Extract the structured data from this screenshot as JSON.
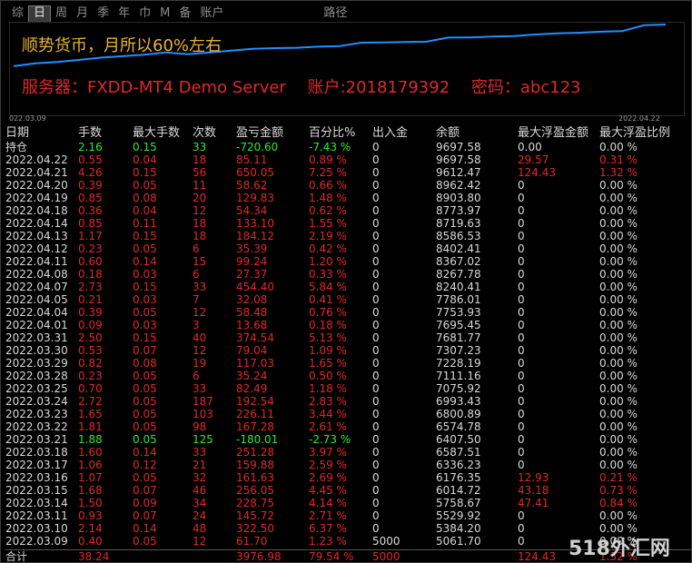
{
  "tabs": [
    "综",
    "日",
    "周",
    "月",
    "季",
    "年",
    "巾",
    "M",
    "备",
    "账户",
    "路径"
  ],
  "active_tab_index": 1,
  "overlay": {
    "line1": "顺势货币，月所以60%左右",
    "server": "服务器：FXDD-MT4 Demo Server",
    "account": "账户:2018179392",
    "password": "密码：abc123"
  },
  "chart": {
    "date_start": "022.03.09",
    "date_end": "2022.04.22",
    "line_color": "#1e90ff",
    "balance_series": [
      5061.7,
      5384.2,
      5529.92,
      5758.67,
      6014.72,
      6176.35,
      6336.23,
      6587.51,
      6407.5,
      6574.78,
      6800.89,
      6993.43,
      7075.92,
      7111.16,
      7228.19,
      7307.23,
      7681.77,
      7695.45,
      7753.93,
      7786.01,
      8240.41,
      8267.78,
      8367.02,
      8402.41,
      8586.53,
      8719.63,
      8773.97,
      8903.8,
      8962.42,
      9612.47,
      9697.58
    ]
  },
  "table": {
    "headers": [
      "日期",
      "手数",
      "最大手数",
      "次数",
      "盈亏金额",
      "百分比%",
      "出入金",
      "余额",
      "最大浮盈金额",
      "最大浮盈比例"
    ],
    "open_row": {
      "date": "持仓",
      "lots": "2.16",
      "max_lots": "0.15",
      "count": "33",
      "pnl": "-720.60",
      "pct": "-7.43 %",
      "inout": "0",
      "balance": "9697.58",
      "max_float": "0.00",
      "max_float_pct": "0.00 %"
    },
    "rows": [
      {
        "date": "2022.04.22",
        "lots": "0.55",
        "max_lots": "0.04",
        "count": "18",
        "pnl": "85.11",
        "pct": "0.89 %",
        "inout": "0",
        "balance": "9697.58",
        "max_float": "29.57",
        "max_float_pct": "0.31 %"
      },
      {
        "date": "2022.04.21",
        "lots": "4.26",
        "max_lots": "0.15",
        "count": "56",
        "pnl": "650.05",
        "pct": "7.25 %",
        "inout": "0",
        "balance": "9612.47",
        "max_float": "124.43",
        "max_float_pct": "1.32 %"
      },
      {
        "date": "2022.04.20",
        "lots": "0.39",
        "max_lots": "0.05",
        "count": "11",
        "pnl": "58.62",
        "pct": "0.66 %",
        "inout": "0",
        "balance": "8962.42",
        "max_float": "0",
        "max_float_pct": "0.00 %"
      },
      {
        "date": "2022.04.19",
        "lots": "0.85",
        "max_lots": "0.08",
        "count": "20",
        "pnl": "129.83",
        "pct": "1.48 %",
        "inout": "0",
        "balance": "8903.80",
        "max_float": "0",
        "max_float_pct": "0.00 %"
      },
      {
        "date": "2022.04.18",
        "lots": "0.36",
        "max_lots": "0.04",
        "count": "12",
        "pnl": "54.34",
        "pct": "0.62 %",
        "inout": "0",
        "balance": "8773.97",
        "max_float": "0",
        "max_float_pct": "0.00 %"
      },
      {
        "date": "2022.04.14",
        "lots": "0.85",
        "max_lots": "0.11",
        "count": "18",
        "pnl": "133.10",
        "pct": "1.55 %",
        "inout": "0",
        "balance": "8719.63",
        "max_float": "0",
        "max_float_pct": "0.00 %"
      },
      {
        "date": "2022.04.13",
        "lots": "1.17",
        "max_lots": "0.15",
        "count": "18",
        "pnl": "184.12",
        "pct": "2.19 %",
        "inout": "0",
        "balance": "8586.53",
        "max_float": "0",
        "max_float_pct": "0.00 %"
      },
      {
        "date": "2022.04.12",
        "lots": "0.23",
        "max_lots": "0.05",
        "count": "6",
        "pnl": "35.39",
        "pct": "0.42 %",
        "inout": "0",
        "balance": "8402.41",
        "max_float": "0",
        "max_float_pct": "0.00 %"
      },
      {
        "date": "2022.04.11",
        "lots": "0.60",
        "max_lots": "0.14",
        "count": "15",
        "pnl": "99.24",
        "pct": "1.20 %",
        "inout": "0",
        "balance": "8367.02",
        "max_float": "0",
        "max_float_pct": "0.00 %"
      },
      {
        "date": "2022.04.08",
        "lots": "0.18",
        "max_lots": "0.03",
        "count": "6",
        "pnl": "27.37",
        "pct": "0.33 %",
        "inout": "0",
        "balance": "8267.78",
        "max_float": "0",
        "max_float_pct": "0.00 %"
      },
      {
        "date": "2022.04.07",
        "lots": "2.73",
        "max_lots": "0.15",
        "count": "33",
        "pnl": "454.40",
        "pct": "5.84 %",
        "inout": "0",
        "balance": "8240.41",
        "max_float": "0",
        "max_float_pct": "0.00 %"
      },
      {
        "date": "2022.04.05",
        "lots": "0.21",
        "max_lots": "0.03",
        "count": "7",
        "pnl": "32.08",
        "pct": "0.41 %",
        "inout": "0",
        "balance": "7786.01",
        "max_float": "0",
        "max_float_pct": "0.00 %"
      },
      {
        "date": "2022.04.04",
        "lots": "0.39",
        "max_lots": "0.05",
        "count": "12",
        "pnl": "58.48",
        "pct": "0.76 %",
        "inout": "0",
        "balance": "7753.93",
        "max_float": "0",
        "max_float_pct": "0.00 %"
      },
      {
        "date": "2022.04.01",
        "lots": "0.09",
        "max_lots": "0.03",
        "count": "3",
        "pnl": "13.68",
        "pct": "0.18 %",
        "inout": "0",
        "balance": "7695.45",
        "max_float": "0",
        "max_float_pct": "0.00 %"
      },
      {
        "date": "2022.03.31",
        "lots": "2.50",
        "max_lots": "0.15",
        "count": "40",
        "pnl": "374.54",
        "pct": "5.13 %",
        "inout": "0",
        "balance": "7681.77",
        "max_float": "0",
        "max_float_pct": "0.00 %"
      },
      {
        "date": "2022.03.30",
        "lots": "0.53",
        "max_lots": "0.07",
        "count": "12",
        "pnl": "79.04",
        "pct": "1.09 %",
        "inout": "0",
        "balance": "7307.23",
        "max_float": "0",
        "max_float_pct": "0.00 %"
      },
      {
        "date": "2022.03.29",
        "lots": "0.82",
        "max_lots": "0.08",
        "count": "19",
        "pnl": "117.03",
        "pct": "1.65 %",
        "inout": "0",
        "balance": "7228.19",
        "max_float": "0",
        "max_float_pct": "0.00 %"
      },
      {
        "date": "2022.03.28",
        "lots": "0.23",
        "max_lots": "0.05",
        "count": "6",
        "pnl": "35.24",
        "pct": "0.50 %",
        "inout": "0",
        "balance": "7111.16",
        "max_float": "0",
        "max_float_pct": "0.00 %"
      },
      {
        "date": "2022.03.25",
        "lots": "0.70",
        "max_lots": "0.05",
        "count": "33",
        "pnl": "82.49",
        "pct": "1.18 %",
        "inout": "0",
        "balance": "7075.92",
        "max_float": "0",
        "max_float_pct": "0.00 %"
      },
      {
        "date": "2022.03.24",
        "lots": "2.72",
        "max_lots": "0.05",
        "count": "187",
        "pnl": "192.54",
        "pct": "2.83 %",
        "inout": "0",
        "balance": "6993.43",
        "max_float": "0",
        "max_float_pct": "0.00 %"
      },
      {
        "date": "2022.03.23",
        "lots": "1.65",
        "max_lots": "0.05",
        "count": "103",
        "pnl": "226.11",
        "pct": "3.44 %",
        "inout": "0",
        "balance": "6800.89",
        "max_float": "0",
        "max_float_pct": "0.00 %"
      },
      {
        "date": "2022.03.22",
        "lots": "1.81",
        "max_lots": "0.05",
        "count": "98",
        "pnl": "167.28",
        "pct": "2.61 %",
        "inout": "0",
        "balance": "6574.78",
        "max_float": "0",
        "max_float_pct": "0.00 %"
      },
      {
        "date": "2022.03.21",
        "lots": "1.88",
        "max_lots": "0.05",
        "count": "125",
        "pnl": "-180.01",
        "pct": "-2.73 %",
        "inout": "0",
        "balance": "6407.50",
        "max_float": "0",
        "max_float_pct": "0.00 %"
      },
      {
        "date": "2022.03.18",
        "lots": "1.60",
        "max_lots": "0.14",
        "count": "33",
        "pnl": "251.28",
        "pct": "3.97 %",
        "inout": "0",
        "balance": "6587.51",
        "max_float": "0",
        "max_float_pct": "0.00 %"
      },
      {
        "date": "2022.03.17",
        "lots": "1.06",
        "max_lots": "0.12",
        "count": "21",
        "pnl": "159.88",
        "pct": "2.59 %",
        "inout": "0",
        "balance": "6336.23",
        "max_float": "0",
        "max_float_pct": "0.00 %"
      },
      {
        "date": "2022.03.16",
        "lots": "1.07",
        "max_lots": "0.05",
        "count": "32",
        "pnl": "161.63",
        "pct": "2.69 %",
        "inout": "0",
        "balance": "6176.35",
        "max_float": "12.93",
        "max_float_pct": "0.21 %"
      },
      {
        "date": "2022.03.15",
        "lots": "1.68",
        "max_lots": "0.07",
        "count": "46",
        "pnl": "256.05",
        "pct": "4.45 %",
        "inout": "0",
        "balance": "6014.72",
        "max_float": "43.18",
        "max_float_pct": "0.73 %"
      },
      {
        "date": "2022.03.14",
        "lots": "1.50",
        "max_lots": "0.09",
        "count": "34",
        "pnl": "228.75",
        "pct": "4.14 %",
        "inout": "0",
        "balance": "5758.67",
        "max_float": "47.41",
        "max_float_pct": "0.84 %"
      },
      {
        "date": "2022.03.11",
        "lots": "0.93",
        "max_lots": "0.07",
        "count": "24",
        "pnl": "145.72",
        "pct": "2.71 %",
        "inout": "0",
        "balance": "5529.92",
        "max_float": "0",
        "max_float_pct": "0.00 %"
      },
      {
        "date": "2022.03.10",
        "lots": "2.14",
        "max_lots": "0.14",
        "count": "48",
        "pnl": "322.50",
        "pct": "6.37 %",
        "inout": "0",
        "balance": "5384.20",
        "max_float": "0",
        "max_float_pct": "0.00 %"
      },
      {
        "date": "2022.03.09",
        "lots": "0.40",
        "max_lots": "0.05",
        "count": "12",
        "pnl": "61.70",
        "pct": "1.23 %",
        "inout": "5000",
        "balance": "5061.70",
        "max_float": "0",
        "max_float_pct": "0.00 %"
      }
    ],
    "total_row": {
      "date": "合计",
      "lots": "38.24",
      "max_lots": "",
      "count": "",
      "pnl": "3976.98",
      "pct": "79.54 %",
      "inout": "5000",
      "balance": "",
      "max_float": "124.43",
      "max_float_pct": "1.32 %"
    }
  },
  "colors": {
    "positive": "#e02828",
    "negative": "#2ee82e",
    "neutral": "#d9d9d9",
    "overlay_title": "#e8b32e"
  },
  "watermark": "518外汇网"
}
